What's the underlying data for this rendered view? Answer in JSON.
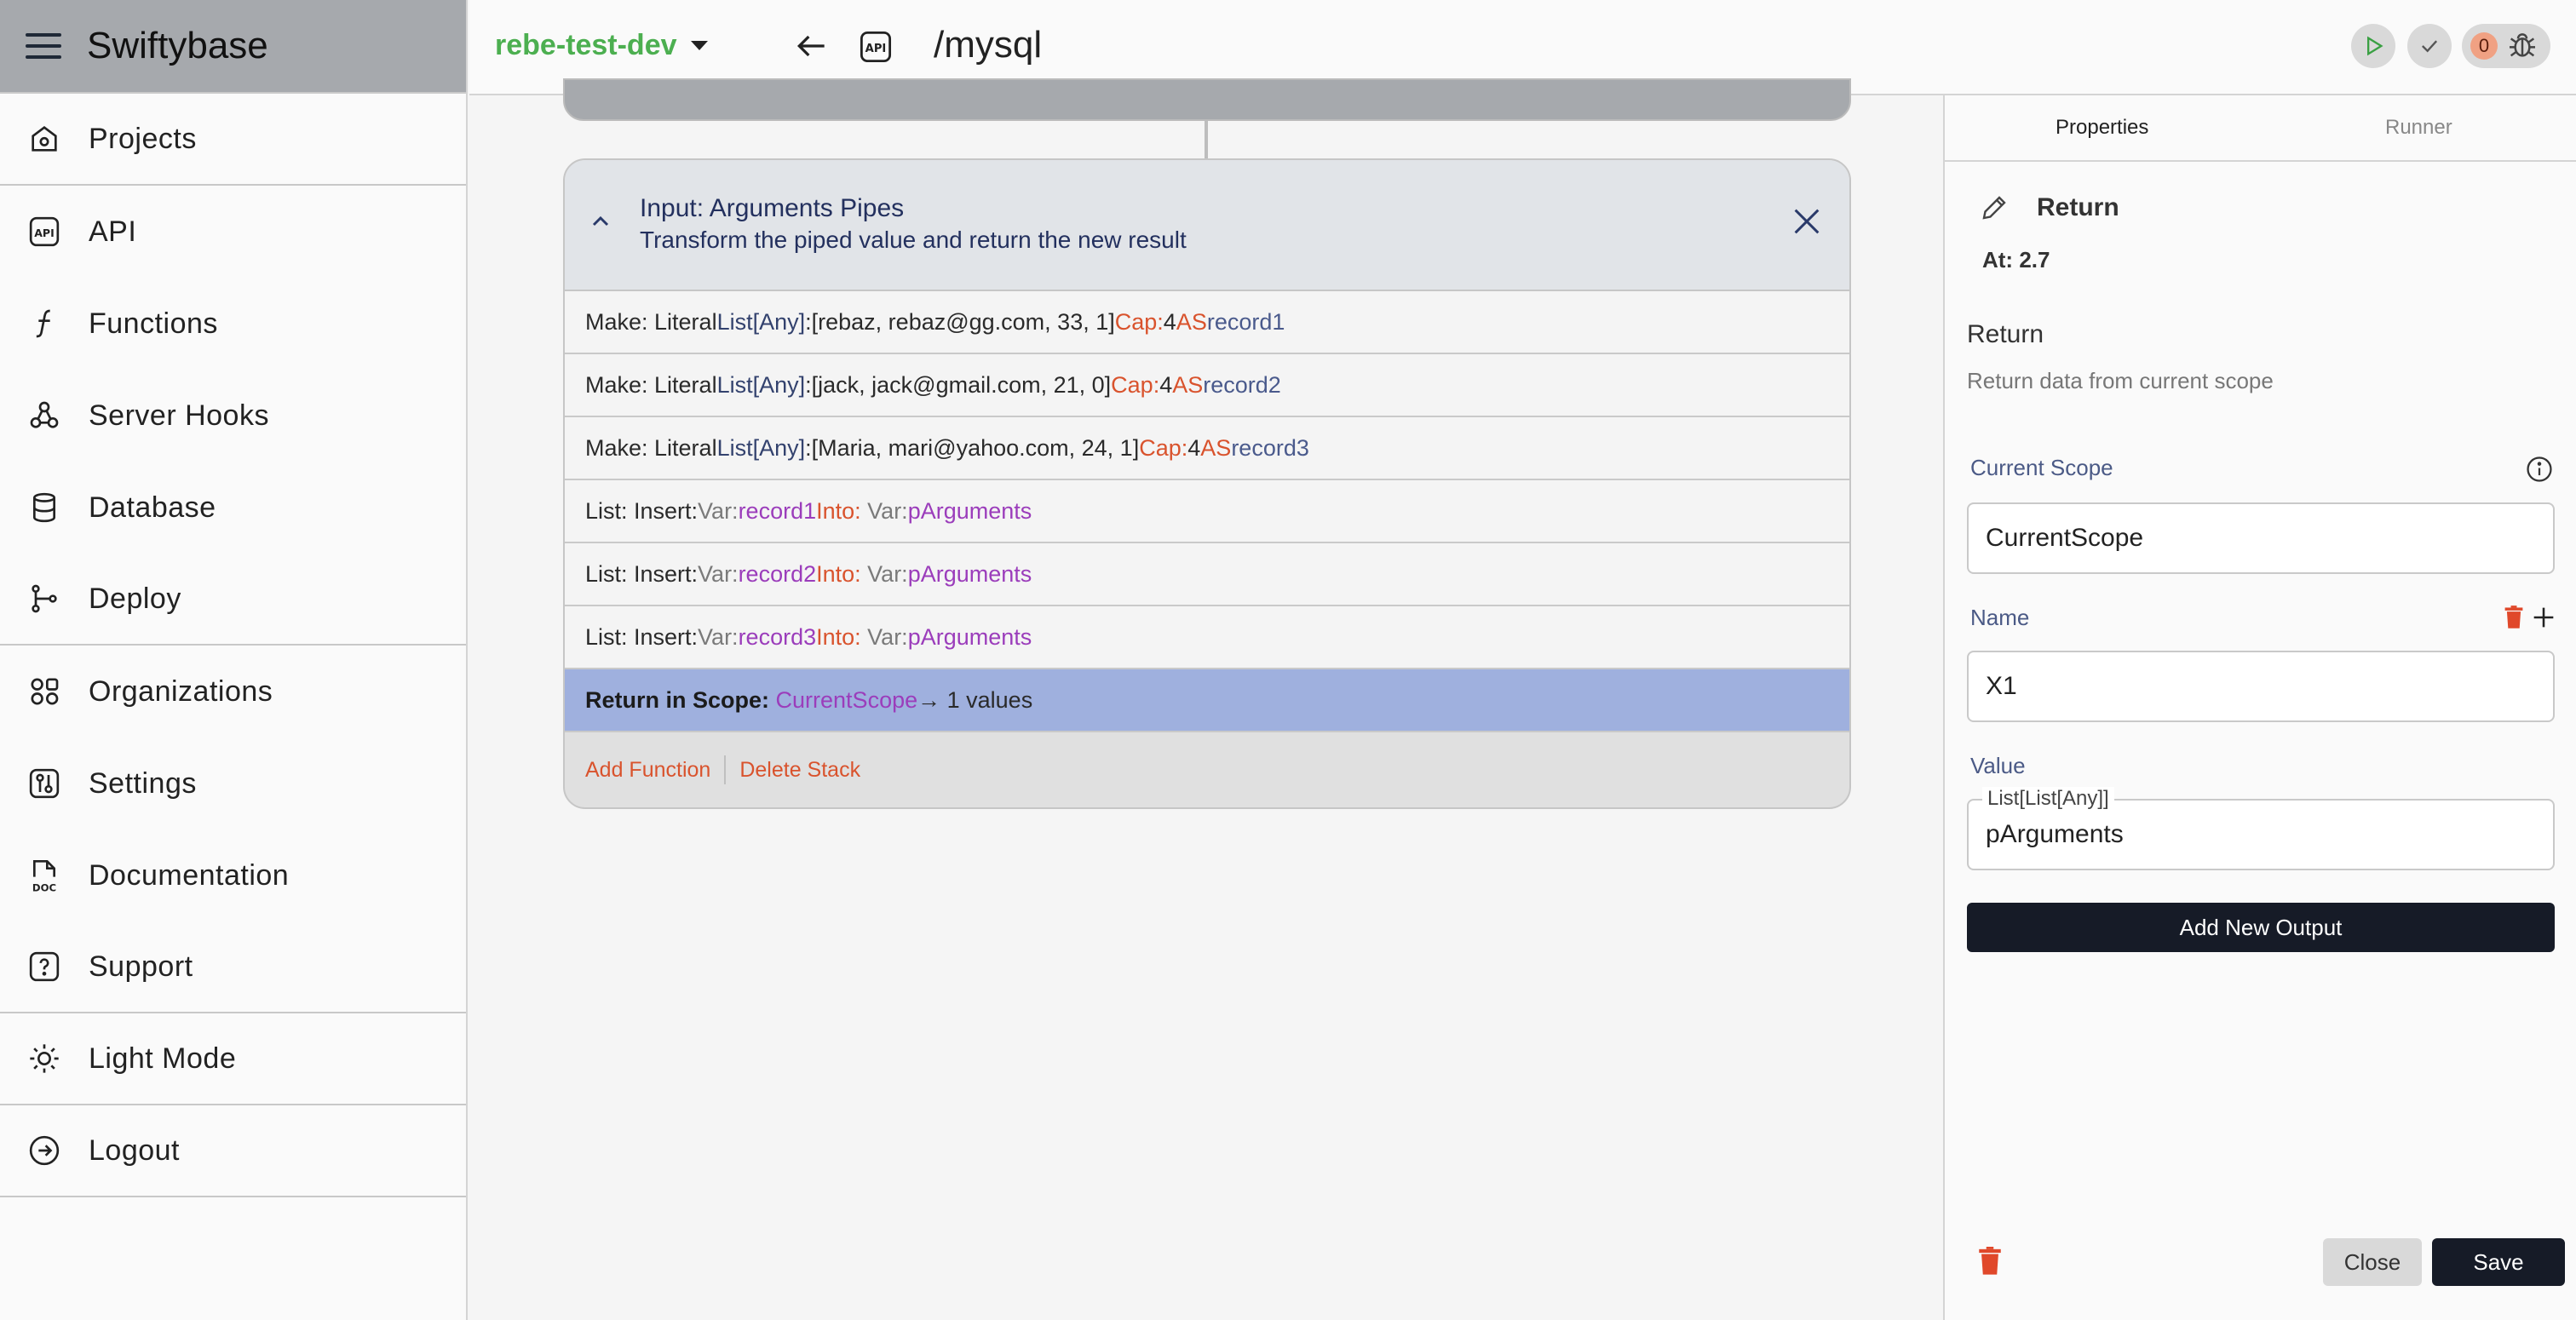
{
  "sidebar": {
    "title": "Swiftybase",
    "items": [
      {
        "label": "Projects",
        "icon": "house-icon"
      },
      {
        "label": "API",
        "icon": "api-icon"
      },
      {
        "label": "Functions",
        "icon": "function-icon"
      },
      {
        "label": "Server Hooks",
        "icon": "webhook-icon"
      },
      {
        "label": "Database",
        "icon": "database-icon"
      },
      {
        "label": "Deploy",
        "icon": "git-branch-icon"
      },
      {
        "label": "Organizations",
        "icon": "organizations-icon"
      },
      {
        "label": "Settings",
        "icon": "settings-icon"
      },
      {
        "label": "Documentation",
        "icon": "doc-icon"
      },
      {
        "label": "Support",
        "icon": "help-icon"
      },
      {
        "label": "Light Mode",
        "icon": "sun-icon"
      },
      {
        "label": "Logout",
        "icon": "logout-icon"
      }
    ],
    "doc_icon_text": "DOC"
  },
  "topbar": {
    "environment": "rebe-test-dev",
    "api_icon_text": "API",
    "route": "/mysql",
    "badge_count": "0"
  },
  "stack": {
    "title": "Input: Arguments Pipes",
    "subtitle": "Transform the piped value and return the new result",
    "rows": [
      {
        "prefix": "Make: Literal ",
        "type": "List[Any]",
        "colon": ": ",
        "value": "[rebaz, rebaz@gg.com, 33, 1] ",
        "cap": "Cap: ",
        "capval": "4 ",
        "as": "AS ",
        "name": "record1"
      },
      {
        "prefix": "Make: Literal ",
        "type": "List[Any]",
        "colon": ": ",
        "value": "[jack, jack@gmail.com, 21, 0] ",
        "cap": "Cap: ",
        "capval": "4 ",
        "as": "AS ",
        "name": "record2"
      },
      {
        "prefix": "Make: Literal ",
        "type": "List[Any]",
        "colon": ": ",
        "value": "[Maria, mari@yahoo.com, 24, 1] ",
        "cap": "Cap: ",
        "capval": "4 ",
        "as": "AS ",
        "name": "record3"
      }
    ],
    "inserts": [
      {
        "prefix": "List: Insert: ",
        "var1": "Var: ",
        "v1": "record1",
        "into": " Into: ",
        "var2": "Var: ",
        "v2": "pArguments"
      },
      {
        "prefix": "List: Insert: ",
        "var1": "Var: ",
        "v1": "record2",
        "into": " Into: ",
        "var2": "Var: ",
        "v2": "pArguments"
      },
      {
        "prefix": "List: Insert: ",
        "var1": "Var: ",
        "v1": "record3",
        "into": " Into: ",
        "var2": "Var: ",
        "v2": "pArguments"
      }
    ],
    "return_row": {
      "label": "Return in Scope: ",
      "scope": "CurrentScope",
      "suffix": " → 1 values"
    },
    "add_function": "Add Function",
    "delete_stack": "Delete Stack"
  },
  "panel": {
    "tabs": [
      "Properties",
      "Runner"
    ],
    "header": "Return",
    "at": "At: 2.7",
    "name": "Return",
    "description": "Return data from current scope",
    "current_scope_label": "Current Scope",
    "current_scope_value": "CurrentScope",
    "name_label": "Name",
    "name_value": "X1",
    "value_label": "Value",
    "value_type": "List[List[Any]]",
    "value_value": "pArguments",
    "add_output": "Add New Output",
    "close": "Close",
    "save": "Save"
  },
  "colors": {
    "accent_green": "#4caf50",
    "orange": "#d9532d",
    "purple": "#9b3dbb",
    "selected_row": "#9fb0de",
    "dark_button": "#161b27"
  }
}
